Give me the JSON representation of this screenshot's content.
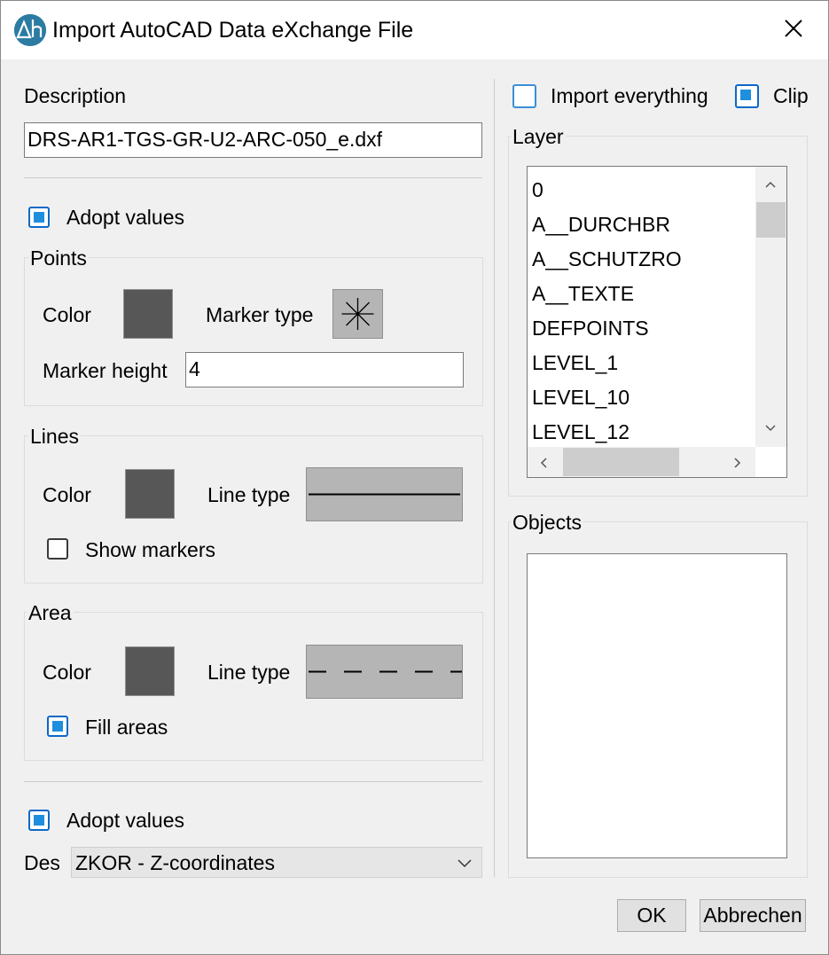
{
  "window": {
    "title": "Import AutoCAD Data eXchange File",
    "accent": "#1e8ede"
  },
  "left": {
    "description_label": "Description",
    "description_value": "DRS-AR1-TGS-GR-U2-ARC-050_e.dxf",
    "adopt_values_label": "Adopt values",
    "adopt_values_checked": true,
    "points": {
      "group_label": "Points",
      "color_label": "Color",
      "marker_type_label": "Marker type",
      "marker_height_label": "Marker height",
      "marker_height_value": "4"
    },
    "lines": {
      "group_label": "Lines",
      "color_label": "Color",
      "line_type_label": "Line type",
      "show_markers_label": "Show markers",
      "show_markers_checked": false
    },
    "area": {
      "group_label": "Area",
      "color_label": "Color",
      "line_type_label": "Line type",
      "fill_areas_label": "Fill areas",
      "fill_areas_checked": true
    },
    "adopt_values2_label": "Adopt values",
    "adopt_values2_checked": true,
    "des_label": "Des",
    "des_value": "ZKOR - Z-coordinates"
  },
  "right": {
    "import_everything_label": "Import everything",
    "import_everything_checked": false,
    "clip_label": "Clip",
    "clip_checked": true,
    "layer_label": "Layer",
    "layers": [
      "0",
      "A__DURCHBR",
      "A__SCHUTZRO",
      "A__TEXTE",
      "DEFPOINTS",
      "LEVEL_1",
      "LEVEL_10",
      "LEVEL_12"
    ],
    "objects_label": "Objects"
  },
  "buttons": {
    "ok": "OK",
    "cancel": "Abbrechen"
  },
  "colors": {
    "swatch": "#575757",
    "preview_bg": "#b5b5b5"
  }
}
